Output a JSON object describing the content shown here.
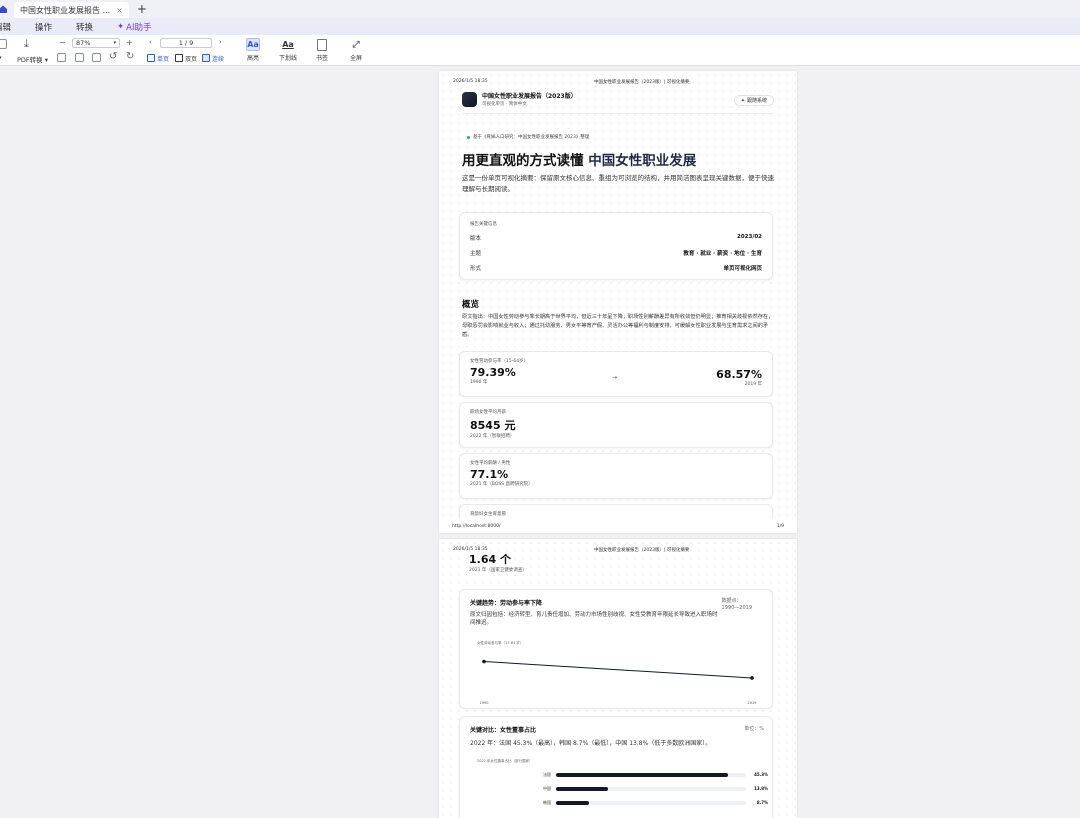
{
  "app": {
    "tab_title": "中国女性职业发展报告 ...",
    "tab_close": "×",
    "new_tab": "+"
  },
  "menu": {
    "items": [
      "编辑",
      "操作",
      "转换"
    ],
    "ai_label": "AI助手"
  },
  "toolbar": {
    "pdf_convert": "PDF转换",
    "zoom": "87%",
    "page_indicator": "1 / 9",
    "view_single": "单页",
    "view_double": "双页",
    "view_continuous": "连续",
    "highlight": "高亮",
    "underline": "下划线",
    "bookmark": "书签",
    "fullscreen": "全屏",
    "aa": "Aa"
  },
  "page_header": {
    "date": "2026/1/5 18:35",
    "title": "中国女性职业发展报告（2023版）| 可视化摘要"
  },
  "page_footer": {
    "url": "http://localhost:8000/",
    "page1": "1/9"
  },
  "report": {
    "brand_name": "中国女性职业发展报告（2023版）",
    "brand_sub": "可视化单页 · 简体中文",
    "theme_button": "跟随系统",
    "source": "基于《育娲人口研究：中国女性职业发展报告 2023》整理",
    "hero_prefix": "用更直观的方式读懂",
    "hero_highlight": "中国女性职业发展",
    "intro": "这是一份单页可视化摘要：保留原文核心信息、重组为可浏览的结构，并用简洁图表呈现关键数据，便于快速理解与长期阅读。",
    "info": {
      "title": "报告关键信息",
      "rows": [
        {
          "k": "版本",
          "v": "2023/02"
        },
        {
          "k": "主题",
          "v": "教育 · 就业 · 薪资 · 地位 · 生育"
        },
        {
          "k": "形式",
          "v": "单页可视化网页"
        }
      ]
    },
    "overview_title": "概览",
    "overview": "原文指出：中国女性劳动参与率长期高于世界平均，但近三十年呈下降；职场性别薪酬差异有所收敛但仍明显；推育相关歧视依然存在，母职惩罚会影响就业与收入；通过托幼服务、男女平等育产假、灵活办公等福利与制度安排，可缓解女性职业发展与生育需求之间的矛盾。",
    "stats": [
      {
        "label": "女性劳动参与率（15-64岁）",
        "value": "79.39%",
        "sub": "1990 年",
        "value2": "68.57%",
        "sub2": "2019 年",
        "arrow": "→"
      },
      {
        "label": "职场女性平均月薪",
        "value": "8545 元",
        "sub": "2022 年（智联招聘）"
      },
      {
        "label": "女性平均薪酬 / 男性",
        "value": "77.1%",
        "sub": "2021 年（BOSS 直聘研究院）"
      },
      {
        "label": "育龄妇女生育意愿"
      }
    ]
  },
  "page2": {
    "top_value": "1.64 个",
    "top_sub": "2021 年（国家卫健委调查）",
    "trend": {
      "title": "关键趋势：劳动参与率下降",
      "desc": "原文归因包括：经济转型、育儿责任增加、劳动力市场性别歧视、女性受教育年限延长导致进入职场时间推迟。",
      "meta_label": "数据点：",
      "meta_range": "1990—2019",
      "chart_label": "女性劳动参与率（15-64 岁）"
    },
    "compare": {
      "title": "关键对比：女性董事占比",
      "desc": "2022 年：法国 45.3%（最高），韩国 8.7%（最低），中国 13.8%（低于多数欧洲国家）。",
      "meta": "单位：%",
      "chart_label": "2022 年女性董事占比（部分国家）"
    }
  },
  "chart_data": [
    {
      "type": "line",
      "title": "女性劳动参与率（15-64 岁）",
      "x": [
        "1990",
        "2019"
      ],
      "series": [
        {
          "values": [
            79.39,
            68.57
          ]
        }
      ]
    },
    {
      "type": "bar",
      "title": "2022 年女性董事占比（部分国家）",
      "categories": [
        "法国",
        "中国",
        "韩国"
      ],
      "values": [
        45.3,
        13.8,
        8.7
      ],
      "value_labels": [
        "45.3%",
        "13.8%",
        "8.7%"
      ],
      "orientation": "horizontal",
      "xlim": [
        0,
        50
      ]
    }
  ]
}
